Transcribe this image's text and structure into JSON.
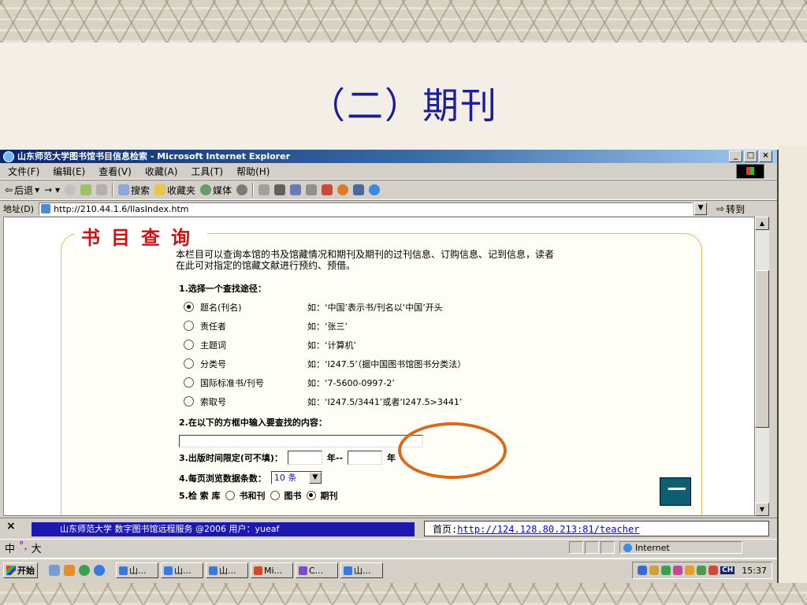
{
  "slide": {
    "title": "（二）期刊"
  },
  "window": {
    "title": "山东师范大学图书馆书目信息检索 - Microsoft Internet Explorer",
    "buttons": {
      "minimize": "_",
      "maximize": "□",
      "close": "×"
    }
  },
  "menu": [
    "文件(F)",
    "编辑(E)",
    "查看(V)",
    "收藏(A)",
    "工具(T)",
    "帮助(H)"
  ],
  "toolbar": {
    "back": "后退",
    "search": "搜索",
    "favorites": "收藏夹",
    "media": "媒体"
  },
  "address": {
    "label": "地址(D)",
    "url": "http://210.44.1.6/IlasIndex.htm",
    "go": "转到"
  },
  "page": {
    "heading": "书目查询",
    "intro": "本栏目可以查询本馆的书及馆藏情况和期刊及期刊的过刊信息、订购信息、记到信息，读者在此可对指定的馆藏文献进行预约、预借。",
    "step1": "1.选择一个查找途径：",
    "options": [
      {
        "label": "题名(刊名)",
        "example": "如：‘中国’表示书/刊名以‘中国’开头",
        "selected": true
      },
      {
        "label": "责任者",
        "example": "如：‘张三’",
        "selected": false
      },
      {
        "label": "主题词",
        "example": "如：‘计算机’",
        "selected": false
      },
      {
        "label": "分类号",
        "example": "如：‘I247.5’（据中国图书馆图书分类法）",
        "selected": false
      },
      {
        "label": "国际标准书/刊号",
        "example": "如：‘7-5600-0997-2’",
        "selected": false
      },
      {
        "label": "索取号",
        "example": "如：‘I247.5/3441’或者‘I247.5>3441’",
        "selected": false
      }
    ],
    "step2": "2.在以下的方框中输入要查找的内容：",
    "step3": "3.出版时间限定(可不填)：",
    "step3_mid": "年--",
    "step3_end": "年",
    "step4": "4.每页浏览数据条数：",
    "per_page": "10 条",
    "step5": "5.检 索 库",
    "db": [
      {
        "label": "书和刊",
        "selected": false
      },
      {
        "label": "图书",
        "selected": false
      },
      {
        "label": "期刊",
        "selected": true
      }
    ]
  },
  "subbar": {
    "close": "×",
    "banner": "山东师范大学 数字图书馆远程服务 @2006 用户：yueaf",
    "home_label": "首页:",
    "home_url": "http://124.128.80.213:81/teacher"
  },
  "status": {
    "ime": [
      "中",
      "°,",
      "大"
    ],
    "zone": "Internet"
  },
  "taskbar": {
    "start": "开始",
    "tasks": [
      "山...",
      "山...",
      "山...",
      "Mi...",
      "C...",
      "山..."
    ],
    "tray_lang": "CH",
    "clock": "15:37"
  },
  "colors": {
    "title": "#1d1d9a",
    "heading": "#c81414",
    "ring": "#d96a1a",
    "banner": "#1c18b0"
  }
}
